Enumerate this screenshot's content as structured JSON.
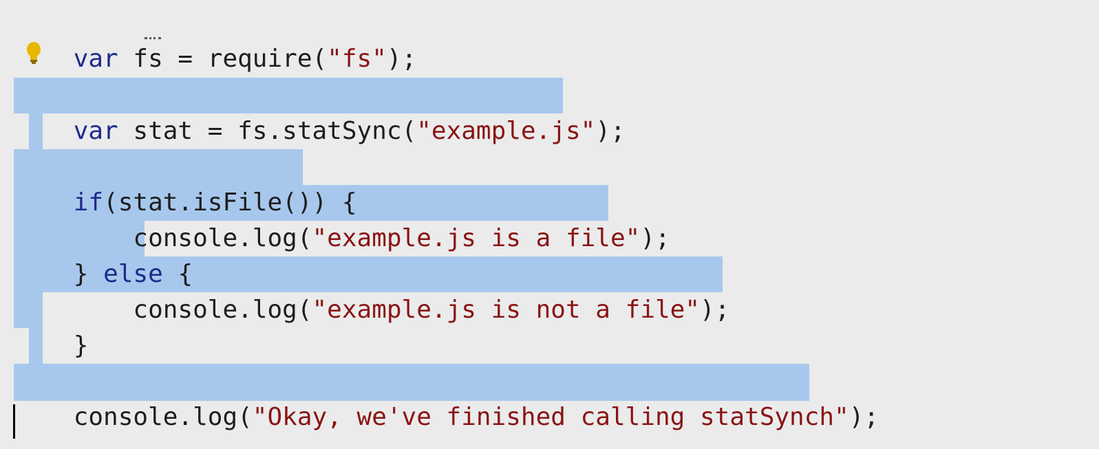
{
  "code": {
    "line1": {
      "kw": "var",
      "rest1": " fs = ",
      "fn": "require",
      "str": "\"fs\"",
      "end": ");"
    },
    "line3": {
      "kw": "var",
      "rest1": " stat = fs.statSync(",
      "str": "\"example.js\"",
      "end": ");"
    },
    "line5": {
      "kw": "if",
      "rest1": "(stat.isFile()) {"
    },
    "line6": {
      "indent": "    ",
      "rest1": "console.log(",
      "str": "\"example.js is a file\"",
      "end": ");"
    },
    "line7": {
      "brace": "} ",
      "kw": "else",
      "rest1": " {"
    },
    "line8": {
      "indent": "    ",
      "rest1": "console.log(",
      "str": "\"example.js is not a file\"",
      "end": ");"
    },
    "line9": {
      "brace": "}"
    },
    "line11": {
      "rest1": "console.log(",
      "str": "\"Okay, we've finished calling statSynch\"",
      "end": ");"
    }
  },
  "icons": {
    "lightbulb": "lightbulb-icon"
  },
  "colors": {
    "background": "#ebebeb",
    "selection": "#a7c8ec",
    "keyword": "#1e2a8c",
    "string": "#8a1414",
    "text": "#1e1e1e",
    "bulb": "#e8b800"
  }
}
